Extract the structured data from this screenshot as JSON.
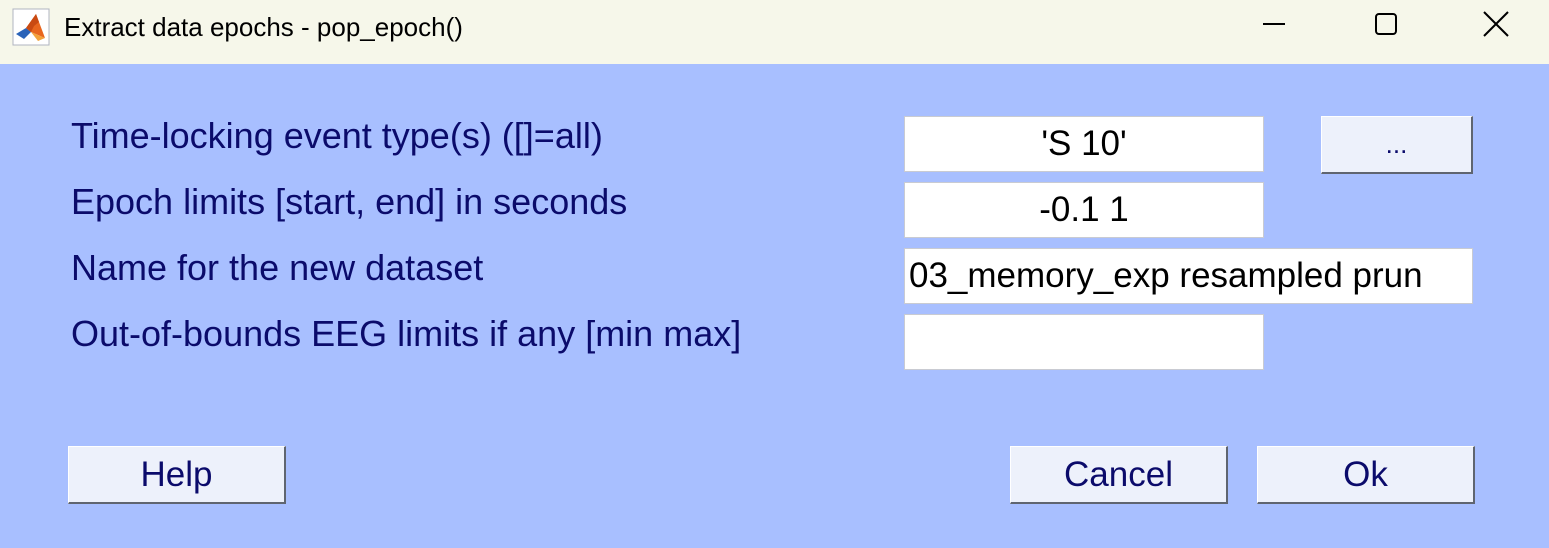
{
  "window": {
    "title": "Extract data epochs - pop_epoch()",
    "icon": "matlab-icon",
    "controls": {
      "minimize_icon": "minimize-icon",
      "maximize_icon": "maximize-icon",
      "close_icon": "close-icon"
    }
  },
  "form": {
    "event_type": {
      "label": "Time-locking event type(s) ([]=all)",
      "value": "'S 10'",
      "browse_label": "..."
    },
    "epoch_limits": {
      "label": "Epoch limits [start, end] in seconds",
      "value": "-0.1 1"
    },
    "dataset_name": {
      "label": "Name for the new dataset",
      "value": "03_memory_exp resampled prun"
    },
    "oob_limits": {
      "label": "Out-of-bounds EEG limits if any [min max]",
      "value": ""
    }
  },
  "buttons": {
    "help": "Help",
    "cancel": "Cancel",
    "ok": "Ok"
  },
  "colors": {
    "background": "#a8bfff",
    "titlebar": "#f6f7ea",
    "label_text": "#0b0b6b",
    "button_face": "#edf1fb"
  }
}
